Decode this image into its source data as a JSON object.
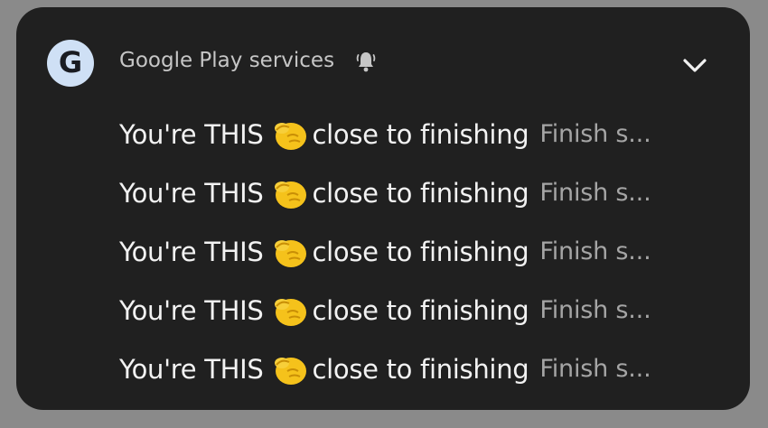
{
  "notification": {
    "app_icon_letter": "G",
    "app_name": "Google Play services",
    "alert_icon": "bell-ringing-icon",
    "expand_icon": "chevron-down-icon",
    "colors": {
      "card_background": "#202020",
      "icon_background": "#cfe0f5",
      "title_text": "#f2f2f2",
      "preview_text": "#a5a5a5",
      "emoji_yellow": "#f5c21b"
    },
    "items": [
      {
        "title_before": "You're THIS",
        "emoji": "pinching-hand-emoji",
        "title_after": "close to finishing",
        "preview": "Finish s..."
      },
      {
        "title_before": "You're THIS",
        "emoji": "pinching-hand-emoji",
        "title_after": "close to finishing",
        "preview": "Finish s..."
      },
      {
        "title_before": "You're THIS",
        "emoji": "pinching-hand-emoji",
        "title_after": "close to finishing",
        "preview": "Finish s..."
      },
      {
        "title_before": "You're THIS",
        "emoji": "pinching-hand-emoji",
        "title_after": "close to finishing",
        "preview": "Finish s..."
      },
      {
        "title_before": "You're THIS",
        "emoji": "pinching-hand-emoji",
        "title_after": "close to finishing",
        "preview": "Finish s..."
      }
    ]
  }
}
